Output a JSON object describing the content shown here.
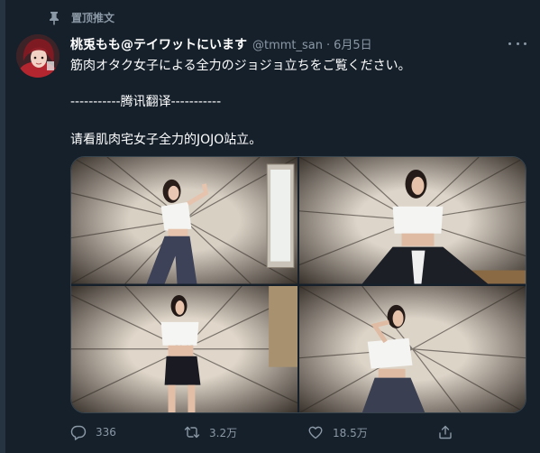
{
  "pinned_label": "置顶推文",
  "tweet": {
    "display_name": "桃兎もも@テイワットにいます",
    "handle": "@tmmt_san",
    "separator": "·",
    "date": "6月5日",
    "text_lines": [
      "筋肉オタク女子による全力のジョジョ立ちをご覧ください。",
      "-----------腾讯翻译-----------",
      "请看肌肉宅女子全力的JOJO站立。"
    ]
  },
  "stats": {
    "replies": "336",
    "retweets": "3.2万",
    "likes": "18.5万"
  },
  "icons": {
    "pin": "pin-icon",
    "more": "more-icon",
    "reply": "reply-icon",
    "retweet": "retweet-icon",
    "like": "heart-icon",
    "share": "share-icon"
  },
  "colors": {
    "background": "#15202b",
    "secondary_text": "#8b98a5",
    "primary_text": "#ffffff"
  }
}
